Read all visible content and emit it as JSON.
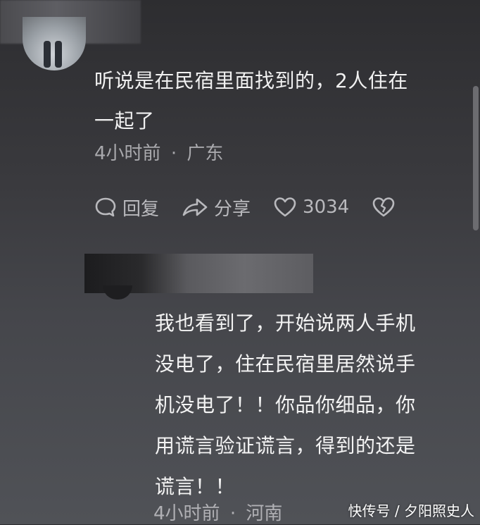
{
  "comment": {
    "text_line1": "听说是在民宿里面找到的，2人住在",
    "text_line2": "一起了",
    "time": "4小时前",
    "separator": "·",
    "location": "广东",
    "actions": {
      "reply_label": "回复",
      "share_label": "分享",
      "like_count": "3034"
    }
  },
  "reply": {
    "lines": [
      "我也看到了，开始说两人手机",
      "没电了，住在民宿里居然说手",
      "机没电了！！你品你细品，你",
      "用谎言验证谎言，得到的还是",
      "谎言！！"
    ],
    "time": "4小时前",
    "separator": "·",
    "location": "河南"
  },
  "watermark": "快传号 / 夕阳照史人",
  "colors": {
    "background_top": "#2d2d30",
    "background_bottom": "#505257",
    "text_primary": "#f1f1f1",
    "text_secondary": "#a9a9ad"
  }
}
